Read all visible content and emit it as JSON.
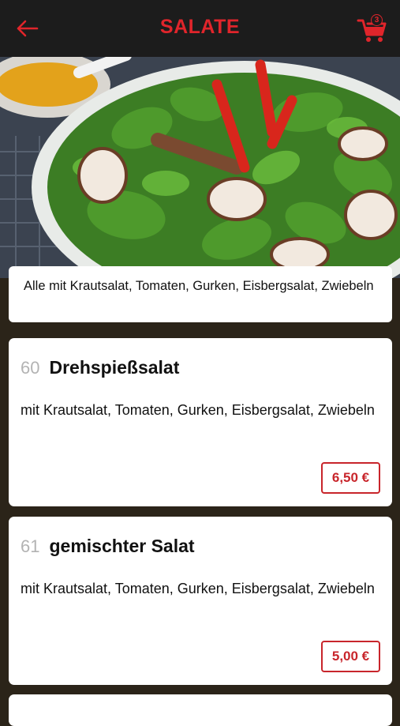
{
  "header": {
    "title": "SALATE",
    "cart_count": "3",
    "accent_color": "#e0252b"
  },
  "hero": {
    "icon": "salad-photo"
  },
  "info": {
    "text": "Alle mit Krautsalat, Tomaten, Gurken, Eisbergsalat, Zwiebeln"
  },
  "items": [
    {
      "number": "60",
      "name": "Drehspießsalat",
      "description": "mit Krautsalat, Tomaten, Gurken, Eisbergsalat, Zwiebeln",
      "price": "6,50 €"
    },
    {
      "number": "61",
      "name": "gemischter Salat",
      "description": "mit Krautsalat, Tomaten, Gurken, Eisbergsalat, Zwiebeln",
      "price": "5,00 €"
    }
  ]
}
